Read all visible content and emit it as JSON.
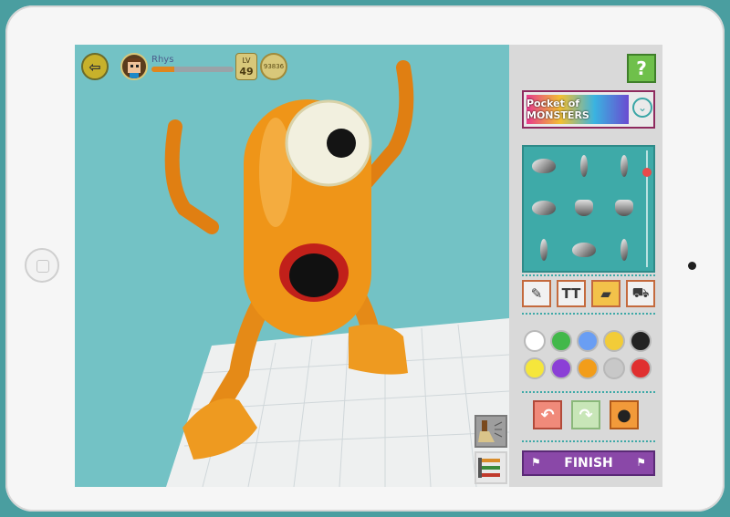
{
  "hud": {
    "player_name": "Rhys",
    "level_label": "LV",
    "level_value": "49",
    "coins": "93836",
    "xp_progress": 0.28
  },
  "side": {
    "help_label": "?",
    "pack_name": "Pocket of MONSTERS",
    "finish_label": "FINISH"
  },
  "modes": [
    "paint",
    "text",
    "folder",
    "shop"
  ],
  "colors": [
    "#ffffff",
    "#42b84a",
    "#6a9ef3",
    "#f2cc38",
    "#222222",
    "#f5e63b",
    "#8b3fd6",
    "#f29d1a",
    "#c8c8c8",
    "#e03030"
  ],
  "icons": {
    "back": "back-arrow-icon",
    "pencil": "pencil-icon",
    "text": "text-tool-icon",
    "folder": "folder-icon",
    "cart": "cart-icon",
    "undo": "undo-icon",
    "redo": "redo-icon",
    "bomb": "bomb-icon",
    "brush": "brush-icon",
    "tools": "tools-icon"
  }
}
